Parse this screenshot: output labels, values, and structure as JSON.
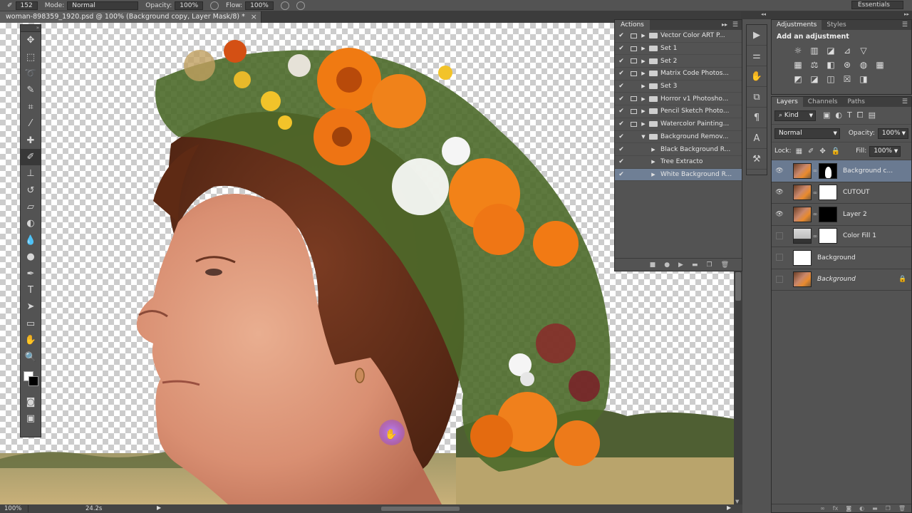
{
  "options_bar": {
    "size_value": "152",
    "mode_label": "Mode:",
    "mode_value": "Normal",
    "opacity_label": "Opacity:",
    "opacity_value": "100%",
    "flow_label": "Flow:",
    "flow_value": "100%",
    "workspace": "Essentials"
  },
  "document": {
    "tab_title": "woman-898359_1920.psd @ 100% (Background copy, Layer Mask/8) *",
    "close_glyph": "×"
  },
  "status_bar": {
    "zoom": "100%",
    "info": "24.2s"
  },
  "tools": [
    {
      "name": "move-tool",
      "glyph": "✥"
    },
    {
      "name": "marquee-tool",
      "glyph": "⬚"
    },
    {
      "name": "lasso-tool",
      "glyph": "➰"
    },
    {
      "name": "quick-select-tool",
      "glyph": "✎"
    },
    {
      "name": "crop-tool",
      "glyph": "⌗"
    },
    {
      "name": "eyedropper-tool",
      "glyph": "⁄"
    },
    {
      "name": "healing-tool",
      "glyph": "✚"
    },
    {
      "name": "brush-tool",
      "glyph": "✐"
    },
    {
      "name": "stamp-tool",
      "glyph": "⊥"
    },
    {
      "name": "history-brush-tool",
      "glyph": "↺"
    },
    {
      "name": "eraser-tool",
      "glyph": "▱"
    },
    {
      "name": "paint-bucket-tool",
      "glyph": "◐"
    },
    {
      "name": "blur-tool",
      "glyph": "💧"
    },
    {
      "name": "dodge-tool",
      "glyph": "●"
    },
    {
      "name": "pen-tool",
      "glyph": "✒"
    },
    {
      "name": "type-tool",
      "glyph": "T"
    },
    {
      "name": "path-select-tool",
      "glyph": "➤"
    },
    {
      "name": "shape-tool",
      "glyph": "▭"
    },
    {
      "name": "hand-tool",
      "glyph": "✋"
    },
    {
      "name": "zoom-tool",
      "glyph": "🔍"
    }
  ],
  "actions_panel": {
    "tab": "Actions",
    "items": [
      {
        "label": "Vector Color  ART P...",
        "checked": true,
        "dialog": true,
        "expanded": false,
        "child": false,
        "selected": false
      },
      {
        "label": "Set 1",
        "checked": true,
        "dialog": true,
        "expanded": false,
        "child": false,
        "selected": false
      },
      {
        "label": "Set 2",
        "checked": true,
        "dialog": true,
        "expanded": false,
        "child": false,
        "selected": false
      },
      {
        "label": "Matrix Code Photos...",
        "checked": true,
        "dialog": true,
        "expanded": false,
        "child": false,
        "selected": false
      },
      {
        "label": "Set 3",
        "checked": true,
        "dialog": false,
        "expanded": false,
        "child": false,
        "selected": false
      },
      {
        "label": "Horror v1 Photosho...",
        "checked": true,
        "dialog": true,
        "expanded": false,
        "child": false,
        "selected": false
      },
      {
        "label": "Pencil Sketch Photo...",
        "checked": true,
        "dialog": true,
        "expanded": false,
        "child": false,
        "selected": false
      },
      {
        "label": "Watercolor Painting...",
        "checked": true,
        "dialog": true,
        "expanded": false,
        "child": false,
        "selected": false
      },
      {
        "label": "Background Remov...",
        "checked": true,
        "dialog": false,
        "expanded": true,
        "child": false,
        "selected": false
      },
      {
        "label": "Black Background R...",
        "checked": true,
        "dialog": false,
        "expanded": false,
        "child": true,
        "selected": false
      },
      {
        "label": "Tree Extracto",
        "checked": true,
        "dialog": false,
        "expanded": false,
        "child": true,
        "selected": false
      },
      {
        "label": "White Background R...",
        "checked": true,
        "dialog": false,
        "expanded": false,
        "child": true,
        "selected": true
      }
    ]
  },
  "adjustments_panel": {
    "tabs": [
      "Adjustments",
      "Styles"
    ],
    "title": "Add an adjustment",
    "rows": [
      [
        "☼",
        "▥",
        "◪",
        "⊿",
        "▽"
      ],
      [
        "▦",
        "⚖",
        "◧",
        "⊛",
        "◍",
        "▦"
      ],
      [
        "◩",
        "◪",
        "◫",
        "☒",
        "◨"
      ]
    ]
  },
  "layers_panel": {
    "tabs": [
      "Layers",
      "Channels",
      "Paths"
    ],
    "kind": "Kind",
    "blend_mode": "Normal",
    "opacity_label": "Opacity:",
    "opacity_value": "100%",
    "lock_label": "Lock:",
    "fill_label": "Fill:",
    "fill_value": "100%",
    "layers": [
      {
        "name": "Background c...",
        "visible": true,
        "thumb": "t-photo",
        "mask": "t-mask",
        "selected": true,
        "italic": false,
        "locked": false
      },
      {
        "name": "CUTOUT",
        "visible": true,
        "thumb": "t-photo",
        "mask": "t-white",
        "selected": false,
        "italic": false,
        "locked": false
      },
      {
        "name": "Layer 2",
        "visible": true,
        "thumb": "t-photo",
        "mask": "t-black",
        "selected": false,
        "italic": false,
        "locked": false
      },
      {
        "name": "Color Fill 1",
        "visible": false,
        "thumb": "t-grey",
        "mask": "t-white",
        "selected": false,
        "italic": false,
        "locked": false
      },
      {
        "name": "Background",
        "visible": false,
        "thumb": "t-white",
        "mask": "",
        "selected": false,
        "italic": false,
        "locked": false
      },
      {
        "name": "Background",
        "visible": false,
        "thumb": "t-photo",
        "mask": "",
        "selected": false,
        "italic": true,
        "locked": true
      }
    ]
  }
}
